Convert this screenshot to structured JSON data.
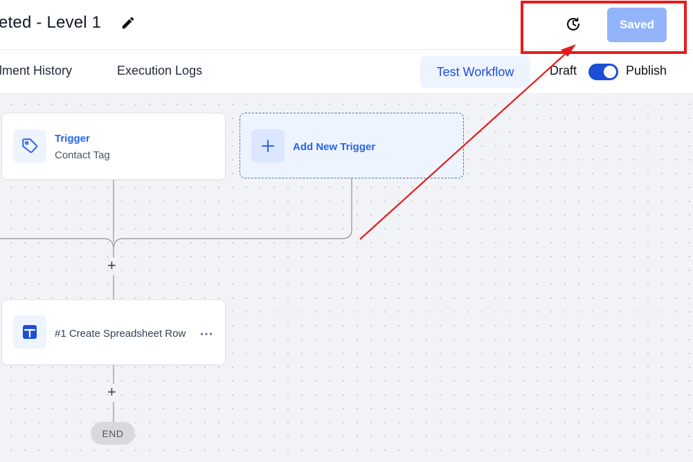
{
  "header": {
    "title": "eted - Level 1",
    "save_label": "Saved"
  },
  "tabs": {
    "enrollment": "lment History",
    "execution": "Execution Logs"
  },
  "toolbar": {
    "test_label": "Test Workflow",
    "draft_label": "Draft",
    "publish_label": "Publish",
    "publish_toggle_on": true
  },
  "canvas": {
    "trigger": {
      "title": "Trigger",
      "subtitle": "Contact Tag",
      "icon": "tag-icon"
    },
    "add_trigger": {
      "label": "Add New Trigger",
      "icon": "plus-icon"
    },
    "action": {
      "label": "#1 Create Spreadsheet Row",
      "icon": "spreadsheet-icon"
    },
    "add_step_symbol": "+",
    "end_label": "END"
  },
  "annotation": {
    "color": "#e61b1b"
  },
  "colors": {
    "accent": "#2563eb",
    "saved_button": "#93b4fb",
    "toggle": "#1d4ed8"
  }
}
